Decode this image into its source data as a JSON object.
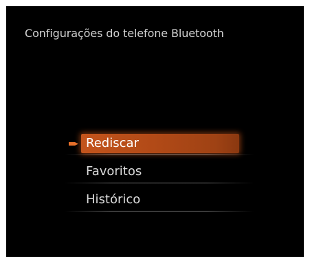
{
  "screen": {
    "title": "Configurações do telefone Bluetooth"
  },
  "menu": {
    "items": [
      {
        "label": "Rediscar",
        "selected": true
      },
      {
        "label": "Favoritos",
        "selected": false
      },
      {
        "label": "Histórico",
        "selected": false
      }
    ],
    "selection_marker_icon": "arrow-marker-icon"
  },
  "colors": {
    "background": "#000000",
    "highlight": "#c3541c",
    "marker": "#e8702a",
    "text": "#dcdcdc"
  }
}
